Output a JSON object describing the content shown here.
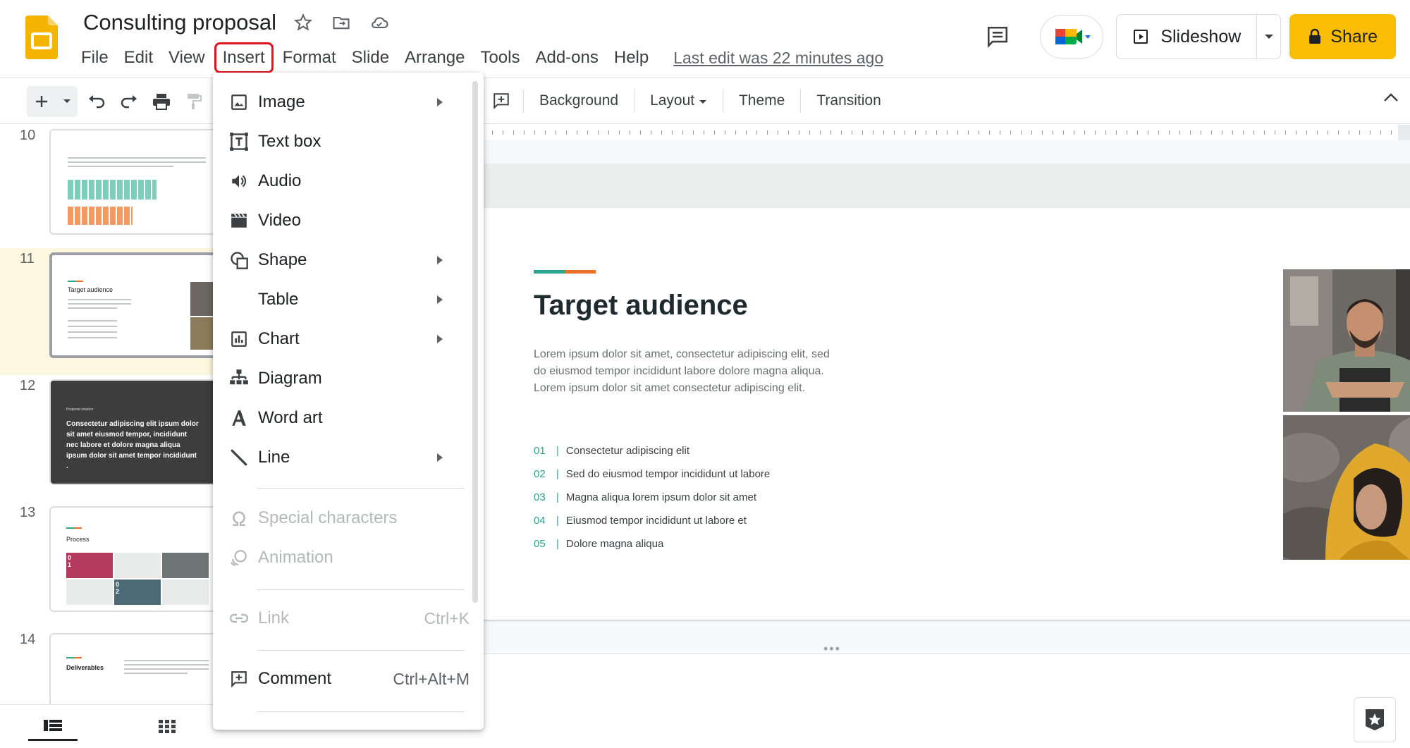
{
  "header": {
    "doc_title": "Consulting proposal",
    "menus": [
      "File",
      "Edit",
      "View",
      "Insert",
      "Format",
      "Slide",
      "Arrange",
      "Tools",
      "Add-ons",
      "Help"
    ],
    "active_menu": "Insert",
    "last_edit": "Last edit was 22 minutes ago",
    "slideshow_label": "Slideshow",
    "share_label": "Share",
    "accent_color": "#fbbc04"
  },
  "toolbar": {
    "background": "Background",
    "layout": "Layout",
    "theme": "Theme",
    "transition": "Transition"
  },
  "filmstrip": {
    "slides": [
      {
        "num": "10"
      },
      {
        "num": "11",
        "title": "Target audience"
      },
      {
        "num": "12",
        "subtitle": "Proposal solution",
        "text": "Consectetur adipiscing elit ipsum dolor sit amet eiusmod tempor, incididunt nec labore et dolore magna aliqua ipsum dolor sit amet tempor incididunt ."
      },
      {
        "num": "13",
        "title": "Process",
        "step1": "0\n1",
        "step2": "0\n2"
      },
      {
        "num": "14",
        "title": "Deliverables"
      }
    ]
  },
  "slide": {
    "title": "Target audience",
    "body": "Lorem ipsum dolor sit amet, consectetur adipiscing elit, sed do eiusmod tempor incididunt labore dolore magna aliqua. Lorem ipsum dolor sit amet consectetur adipiscing elit.",
    "list": [
      {
        "num": "01",
        "text": "Consectetur adipiscing elit"
      },
      {
        "num": "02",
        "text": "Sed do eiusmod tempor incididunt ut labore"
      },
      {
        "num": "03",
        "text": "Magna aliqua lorem ipsum dolor sit amet"
      },
      {
        "num": "04",
        "text": "Eiusmod tempor incididunt ut labore et"
      },
      {
        "num": "05",
        "text": "Dolore magna aliqua"
      }
    ],
    "accent_colors": [
      "#2aa58f",
      "#e8702a"
    ]
  },
  "insert_menu": {
    "items": [
      {
        "label": "Image",
        "submenu": true,
        "icon": "image-icon"
      },
      {
        "label": "Text box",
        "icon": "text-box-icon"
      },
      {
        "label": "Audio",
        "icon": "audio-icon"
      },
      {
        "label": "Video",
        "icon": "video-icon"
      },
      {
        "label": "Shape",
        "submenu": true,
        "icon": "shape-icon"
      },
      {
        "label": "Table",
        "submenu": true
      },
      {
        "label": "Chart",
        "submenu": true,
        "icon": "chart-icon"
      },
      {
        "label": "Diagram",
        "icon": "diagram-icon"
      },
      {
        "label": "Word art",
        "icon": "word-art-icon"
      },
      {
        "label": "Line",
        "submenu": true,
        "icon": "line-icon"
      },
      {
        "label": "Special characters",
        "disabled": true,
        "icon": "omega-icon"
      },
      {
        "label": "Animation",
        "disabled": true,
        "icon": "animation-icon"
      },
      {
        "label": "Link",
        "shortcut": "Ctrl+K",
        "disabled": true,
        "icon": "link-icon"
      },
      {
        "label": "Comment",
        "shortcut": "Ctrl+Alt+M",
        "icon": "comment-icon"
      }
    ]
  }
}
